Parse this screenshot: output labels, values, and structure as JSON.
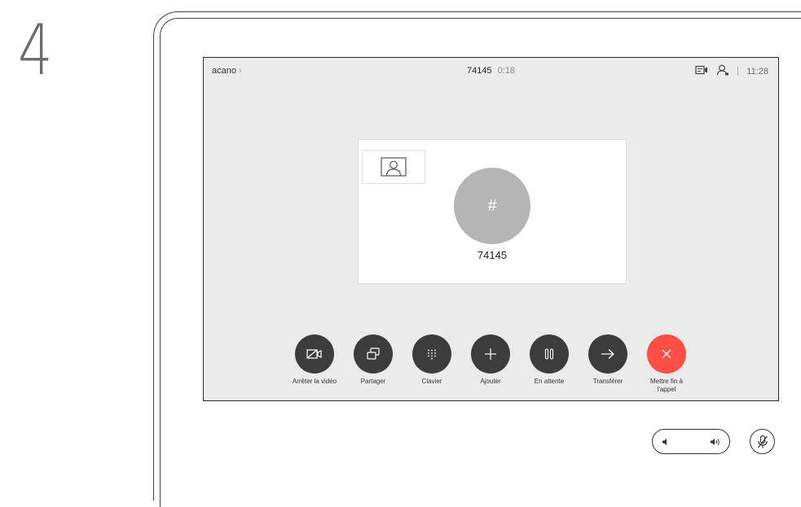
{
  "step": {
    "number": "4"
  },
  "status_bar": {
    "breadcrumb": "acano",
    "call_number": "74145",
    "call_duration": "0:18",
    "time": "11:28"
  },
  "call": {
    "avatar_symbol": "#",
    "remote_number": "74145"
  },
  "controls": [
    {
      "label": "Arrêter la vidéo",
      "icon": "video-off-icon"
    },
    {
      "label": "Partager",
      "icon": "share-icon"
    },
    {
      "label": "Clavier",
      "icon": "keypad-icon"
    },
    {
      "label": "Ajouter",
      "icon": "plus-icon"
    },
    {
      "label": "En attente",
      "icon": "pause-icon"
    },
    {
      "label": "Transférer",
      "icon": "arrow-right-icon"
    },
    {
      "label": "Mettre fin à l'appel",
      "icon": "close-icon",
      "color": "#ff4f45"
    }
  ],
  "colors": {
    "screen_bg": "#ebebeb",
    "button_dark": "#3c3c3c",
    "end_call": "#ff4f45",
    "avatar": "#b5b5b5"
  }
}
